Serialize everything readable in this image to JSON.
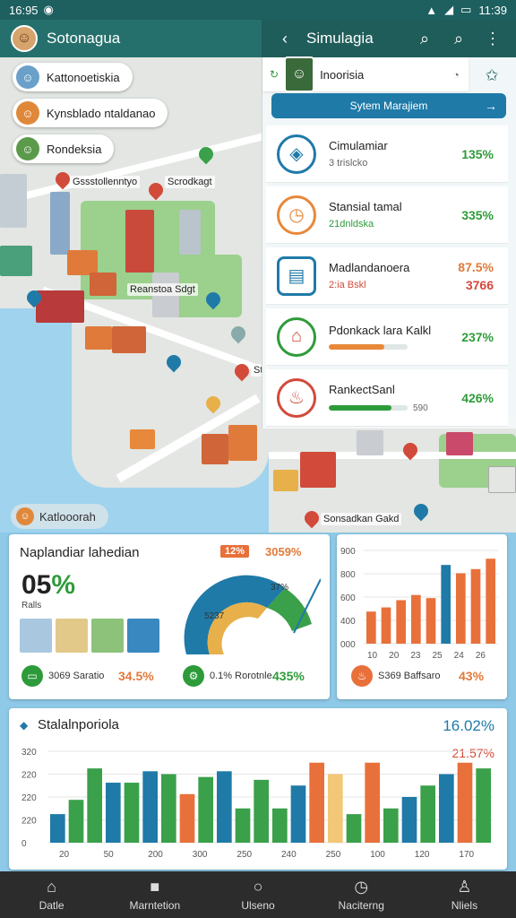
{
  "status_bar": {
    "time": "16:95",
    "right_time": "11:39"
  },
  "app_bar": {
    "title": "Sotonagua",
    "right_title": "Simulagia"
  },
  "map": {
    "chips": [
      "Kattonoetiskia",
      "Kynsblado ntaldanao",
      "Rondeksia"
    ],
    "labels": [
      "Gssstollenntyo",
      "Scrodkagt",
      "Reanstoa Sdgt",
      "Sti",
      "Sonsadkan Gakd"
    ],
    "bottom_chip": "Katlooorah"
  },
  "panel": {
    "head_label": "Inoorisia",
    "system_button": "Sytem Marajiem",
    "items": [
      {
        "title": "Cimulamiar",
        "sub": "3 trislcko",
        "value": "135%",
        "color": "#2e9b3a",
        "icon_color": "#1f7aa8",
        "icon": "location-icon"
      },
      {
        "title": "Stansial tamal",
        "sub": "21dnldska",
        "value": "335%",
        "color": "#2e9b3a",
        "icon_color": "#e8883a",
        "icon": "gauge-icon"
      },
      {
        "title": "Madlandanoera",
        "sub": "2:ia  Bskl",
        "value": "87.5%",
        "value2": "3766",
        "color": "#e07a3a",
        "icon_color": "#1f7aa8",
        "icon": "document-icon"
      },
      {
        "title": "Pdonkack lara Kalkl",
        "sub": "",
        "value": "237%",
        "color": "#2e9b3a",
        "icon_color": "#2e9b3a",
        "icon": "store-icon",
        "progress": 0.7,
        "bar_color": "#e8883a"
      },
      {
        "title": "RankectSanl",
        "sub": "590",
        "value": "426%",
        "color": "#2e9b3a",
        "icon_color": "#d24a3a",
        "icon": "fire-icon",
        "progress": 0.8,
        "bar_color": "#2e9b3a"
      }
    ]
  },
  "card1": {
    "title": "Naplandiar lahedian",
    "big_value": "05",
    "big_unit": "%",
    "badge_left": "12%",
    "badge_right": "3059%",
    "donut_label_1": "37%",
    "donut_label_2": "5237",
    "thumbs_label": "Ralls",
    "stats": [
      {
        "label": "3069 Saratio",
        "value": "34.5%",
        "color": "#2e9b3a"
      },
      {
        "label": "0.1% Rorotnle",
        "value": "435%",
        "color": "#2e9b3a"
      }
    ]
  },
  "card2": {
    "stat_label": "S369 Baffsaro",
    "stat_value": "43%",
    "y_ticks": [
      "900",
      "800",
      "600",
      "400",
      "000"
    ],
    "x_ticks": [
      "10",
      "20",
      "23",
      "25",
      "24",
      "26"
    ]
  },
  "card3": {
    "title": "Stalalnporiola",
    "value_top": "16.02%",
    "value_red": "21.57%",
    "y_ticks": [
      "320",
      "220",
      "220",
      "220",
      "0"
    ],
    "x_ticks": [
      "20",
      "50",
      "200",
      "300",
      "250",
      "240",
      "250",
      "100",
      "120",
      "170"
    ]
  },
  "chart_data": [
    {
      "type": "bar",
      "categories": [
        "10",
        "20",
        "23",
        "25",
        "24",
        "26",
        "",
        "",
        ""
      ],
      "series": [
        {
          "values": [
            310,
            350,
            420,
            470,
            440,
            760,
            680,
            720,
            820
          ],
          "colors": [
            "#e8703a",
            "#e8703a",
            "#e8703a",
            "#e8703a",
            "#e8703a",
            "#1f7aa8",
            "#e8703a",
            "#e8703a",
            "#e8703a"
          ]
        }
      ],
      "ylim": [
        0,
        900
      ]
    },
    {
      "type": "bar",
      "categories": [
        "20",
        "50",
        "200",
        "300",
        "250",
        "240",
        "250",
        "100",
        "120",
        "170"
      ],
      "series": [
        {
          "values": [
            100,
            150,
            260,
            210,
            210,
            250,
            240,
            170,
            230,
            250,
            120,
            220,
            120,
            200,
            280,
            240,
            100,
            280,
            120,
            160,
            200,
            240,
            280,
            260
          ],
          "colors": [
            "#1f7aa8",
            "#3aa04a",
            "#3aa04a",
            "#1f7aa8",
            "#3aa04a",
            "#1f7aa8",
            "#3aa04a",
            "#e8703a",
            "#3aa04a",
            "#1f7aa8",
            "#3aa04a",
            "#3aa04a",
            "#3aa04a",
            "#1f7aa8",
            "#e8703a",
            "#f2c777",
            "#3aa04a",
            "#e8703a",
            "#3aa04a",
            "#1f7aa8",
            "#3aa04a",
            "#1f7aa8",
            "#e8703a",
            "#3aa04a"
          ]
        }
      ],
      "ylim": [
        0,
        320
      ]
    }
  ],
  "bottom_nav": [
    "Datle",
    "Marntetion",
    "Ulseno",
    "Naciterng",
    "Nliels"
  ]
}
